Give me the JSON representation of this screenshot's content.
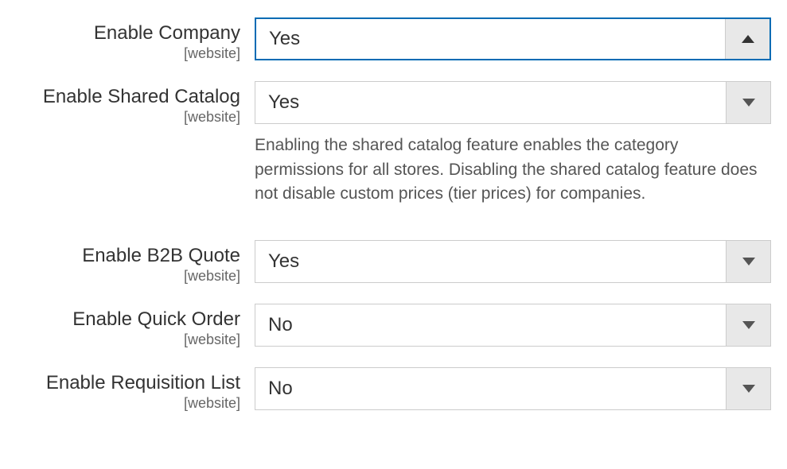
{
  "fields": {
    "enableCompany": {
      "label": "Enable Company",
      "scope": "[website]",
      "value": "Yes"
    },
    "enableSharedCatalog": {
      "label": "Enable Shared Catalog",
      "scope": "[website]",
      "value": "Yes",
      "note": "Enabling the shared catalog feature enables the category permissions for all stores. Disabling the shared catalog feature does not disable custom prices (tier prices) for companies."
    },
    "enableB2BQuote": {
      "label": "Enable B2B Quote",
      "scope": "[website]",
      "value": "Yes"
    },
    "enableQuickOrder": {
      "label": "Enable Quick Order",
      "scope": "[website]",
      "value": "No"
    },
    "enableRequisitionList": {
      "label": "Enable Requisition List",
      "scope": "[website]",
      "value": "No"
    }
  }
}
